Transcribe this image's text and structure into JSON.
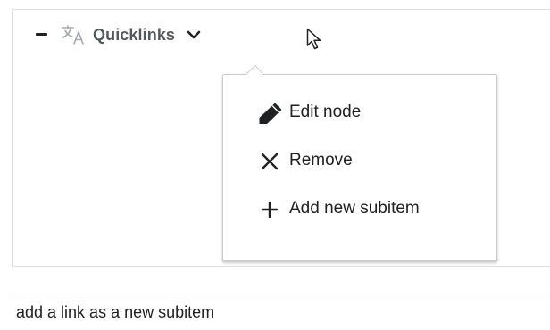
{
  "tree_node": {
    "label": "Quicklinks"
  },
  "icons": {
    "collapse": "minus-icon",
    "language": "translate-icon",
    "expand_menu": "chevron-down-icon",
    "cursor": "mouse-pointer-icon"
  },
  "context_menu": {
    "items": [
      {
        "label": "Edit node",
        "icon": "pencil-icon"
      },
      {
        "label": "Remove",
        "icon": "close-icon"
      },
      {
        "label": "Add new subitem",
        "icon": "plus-icon"
      }
    ]
  },
  "caption": {
    "text": "add a link as a new subitem"
  },
  "colors": {
    "text": "#202122",
    "muted": "#54595d",
    "border": "#c8ccd1"
  }
}
